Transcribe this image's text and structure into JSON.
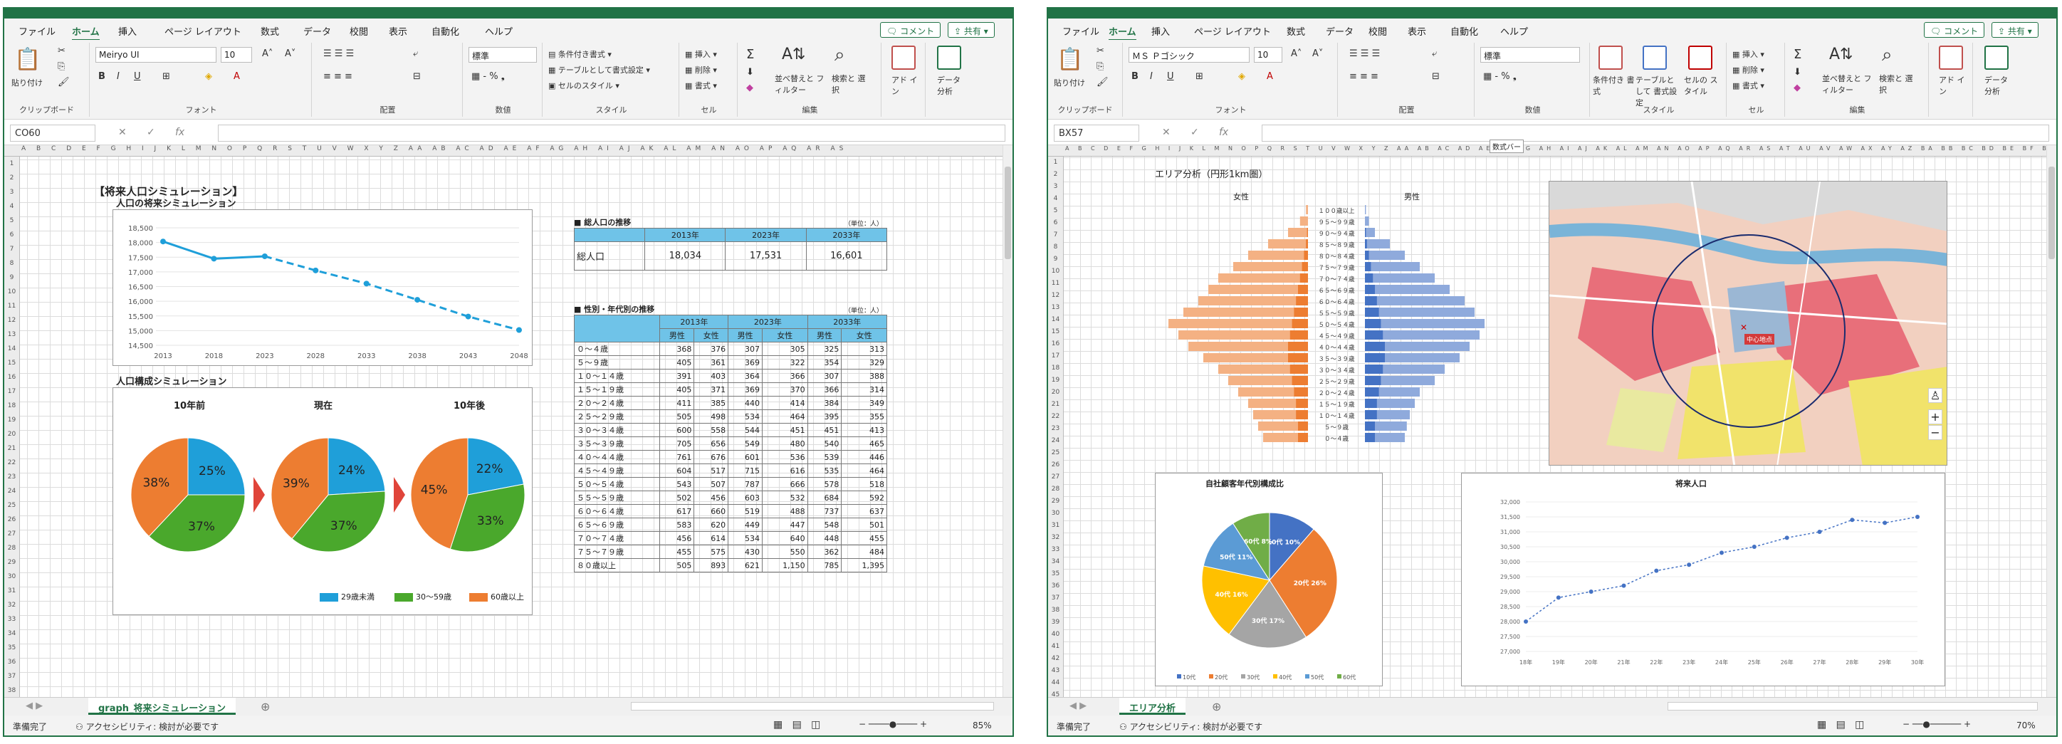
{
  "colors": {
    "excel_green": "#217346",
    "blue": "#1f9fd9",
    "green": "#4aa82c",
    "orange": "#ed7d31",
    "pyr_female": "#f4b183",
    "pyr_male": "#8faadc",
    "pyr_dark_f": "#ed7d31",
    "pyr_dark_m": "#4472c4",
    "table_header": "#6fc3e8"
  },
  "icons": [
    "clipboard-icon",
    "cut-icon",
    "copy-icon",
    "format-painter-icon",
    "bold-icon",
    "italic-icon",
    "underline-icon",
    "align-icon",
    "sum-icon",
    "sort-filter-icon",
    "find-icon",
    "addin-icon",
    "data-analysis-icon",
    "comment-icon",
    "share-icon",
    "add-sheet-icon"
  ],
  "w1": {
    "tabs": [
      "ファイル",
      "ホーム",
      "挿入",
      "ページ レイアウト",
      "数式",
      "データ",
      "校閲",
      "表示",
      "自動化",
      "ヘルプ"
    ],
    "comment_btn": "コメント",
    "share_btn": "共有",
    "ribbon": {
      "paste": "貼り付け",
      "clipboard": "クリップボード",
      "font_name": "Meiryo UI",
      "font_size": "10",
      "font": "フォント",
      "align": "配置",
      "number_format": "標準",
      "number": "数値",
      "cond_format": "条件付き書式",
      "table_format": "テーブルとして書式設定",
      "cell_style": "セルのスタイル",
      "style": "スタイル",
      "insert": "挿入",
      "delete": "削除",
      "format": "書式",
      "cell": "セル",
      "edit": "編集",
      "sort": "並べ替えと フィルター",
      "find": "検索と 選択",
      "addin": "アド イン",
      "data_analysis": "データ 分析"
    },
    "namebox": "CO60",
    "col_headers": "A B C D E F G H I J K L M N O P Q R S T U V W X Y Z AA AB AC AD AE AF AG AH AI AJ AK AL AM AN AO AP AQ AR AS",
    "sheet_title": "【将来人口シミュレーション】",
    "line_title": "人口の将来シミュレーション",
    "pie_section_title": "人口構成シミュレーション",
    "pie_titles": [
      "10年前",
      "現在",
      "10年後"
    ],
    "pie_legend": [
      "29歳未満",
      "30～59歳",
      "60歳以上"
    ],
    "table1_title": "■ 総人口の推移",
    "table1_unit": "（単位：人）",
    "table1_years": [
      "2013年",
      "2023年",
      "2033年"
    ],
    "table1_row_label": "総人口",
    "table1_values": [
      "18,034",
      "17,531",
      "16,601"
    ],
    "table2_title": "■ 性別・年代別の推移",
    "table2_unit": "（単位：人）",
    "table2_sub": [
      "男性",
      "女性"
    ],
    "table2_rows": [
      [
        "０～４歳",
        "368",
        "376",
        "307",
        "305",
        "325",
        "313"
      ],
      [
        "５～９歳",
        "405",
        "361",
        "369",
        "322",
        "354",
        "329"
      ],
      [
        "１０～１４歳",
        "391",
        "403",
        "364",
        "366",
        "307",
        "388"
      ],
      [
        "１５～１９歳",
        "405",
        "371",
        "369",
        "370",
        "366",
        "314"
      ],
      [
        "２０～２４歳",
        "411",
        "385",
        "440",
        "414",
        "384",
        "349"
      ],
      [
        "２５～２９歳",
        "505",
        "498",
        "534",
        "464",
        "395",
        "355"
      ],
      [
        "３０～３４歳",
        "600",
        "558",
        "544",
        "451",
        "451",
        "413"
      ],
      [
        "３５～３９歳",
        "705",
        "656",
        "549",
        "480",
        "540",
        "465"
      ],
      [
        "４０～４４歳",
        "761",
        "676",
        "601",
        "536",
        "539",
        "446"
      ],
      [
        "４５～４９歳",
        "604",
        "517",
        "715",
        "616",
        "535",
        "464"
      ],
      [
        "５０～５４歳",
        "543",
        "507",
        "787",
        "666",
        "578",
        "518"
      ],
      [
        "５５～５９歳",
        "502",
        "456",
        "603",
        "532",
        "684",
        "592"
      ],
      [
        "６０～６４歳",
        "617",
        "660",
        "519",
        "488",
        "737",
        "637"
      ],
      [
        "６５～６９歳",
        "583",
        "620",
        "449",
        "447",
        "548",
        "501"
      ],
      [
        "７０～７４歳",
        "456",
        "614",
        "534",
        "640",
        "448",
        "455"
      ],
      [
        "７５～７９歳",
        "455",
        "575",
        "430",
        "550",
        "362",
        "484"
      ],
      [
        "８０歳以上",
        "505",
        "893",
        "621",
        "1,150",
        "785",
        "1,395"
      ]
    ],
    "sheet_tab": "graph_将来シミュレーション",
    "status_ready": "準備完了",
    "status_access": "アクセシビリティ: 検討が必要です",
    "zoom": "85%"
  },
  "w2": {
    "tabs": [
      "ファイル",
      "ホーム",
      "挿入",
      "ページ レイアウト",
      "数式",
      "データ",
      "校閲",
      "表示",
      "自動化",
      "ヘルプ"
    ],
    "comment_btn": "コメント",
    "share_btn": "共有",
    "ribbon": {
      "paste": "貼り付け",
      "clipboard": "クリップボード",
      "font_name": "ＭＳ Ｐゴシック",
      "font_size": "10",
      "font": "フォント",
      "align": "配置",
      "number_format": "標準",
      "number": "数値",
      "cond_format": "条件付き 書式",
      "table_format": "テーブルとして 書式設定",
      "cell_style": "セルの スタイル",
      "style": "スタイル",
      "insert": "挿入",
      "delete": "削除",
      "format": "書式",
      "cell": "セル",
      "edit": "編集",
      "sort": "並べ替えと フィルター",
      "find": "検索と 選択",
      "addin": "アド イン",
      "data_analysis": "データ 分析"
    },
    "namebox": "BX57",
    "formula_tooltip": "数式バー",
    "area_title": "エリア分析（円形1km圏）",
    "pyr_female": "女性",
    "pyr_male": "男性",
    "pyr_ages": [
      "１００歳以上",
      "９５～９９歳",
      "９０～９４歳",
      "８５～８９歳",
      "８０～８４歳",
      "７５～７９歳",
      "７０～７４歳",
      "６５～６９歳",
      "６０～６４歳",
      "５５～５９歳",
      "５０～５４歳",
      "４５～４９歳",
      "４０～４４歳",
      "３５～３９歳",
      "３０～３４歳",
      "２５～２９歳",
      "２０～２４歳",
      "１５～１９歳",
      "１０～１４歳",
      "５～９歳",
      "０～４歳"
    ],
    "pie2_title": "自社顧客年代別構成比",
    "pie2_labels": [
      "10代 10%",
      "20代 26%",
      "30代 17%",
      "40代 16%",
      "50代 11%",
      "60代 8%"
    ],
    "line2_title": "将来人口",
    "line2_x": [
      "18年",
      "19年",
      "20年",
      "21年",
      "22年",
      "23年",
      "24年",
      "25年",
      "26年",
      "27年",
      "28年",
      "29年",
      "30年"
    ],
    "line2_ylabels": [
      "32,000",
      "31,500",
      "31,000",
      "30,500",
      "30,000",
      "29,500",
      "29,000",
      "28,500",
      "28,000",
      "27,500",
      "27,000"
    ],
    "map_pin": "中心地点",
    "sheet_tab": "エリア分析",
    "status_ready": "準備完了",
    "status_access": "アクセシビリティ: 検討が必要です",
    "zoom": "70%"
  },
  "chart_data": [
    {
      "type": "line",
      "title": "人口の将来シミュレーション",
      "categories": [
        "2013",
        "2018",
        "2023",
        "2028",
        "2033",
        "2038",
        "2043",
        "2048"
      ],
      "values": [
        18034,
        17450,
        17531,
        17050,
        16601,
        16050,
        15480,
        15020
      ],
      "ylim": [
        14500,
        18500
      ],
      "yticks": [
        "18,500",
        "18,000",
        "17,500",
        "17,000",
        "16,500",
        "16,000",
        "15,500",
        "15,000",
        "14,500"
      ],
      "note": "solid through 2023, dashed after"
    },
    {
      "type": "pie",
      "title": "10年前",
      "values": [
        25,
        37,
        38
      ]
    },
    {
      "type": "pie",
      "title": "現在",
      "values": [
        24,
        37,
        39
      ]
    },
    {
      "type": "pie",
      "title": "10年後",
      "values": [
        22,
        33,
        45
      ]
    },
    {
      "type": "pie",
      "title": "自社顧客年代別構成比",
      "values": [
        10,
        26,
        17,
        16,
        11,
        8
      ],
      "categories": [
        "10代",
        "20代",
        "30代",
        "40代",
        "50代",
        "60代"
      ]
    },
    {
      "type": "line",
      "title": "将来人口",
      "categories": [
        "18年",
        "19年",
        "20年",
        "21年",
        "22年",
        "23年",
        "24年",
        "25年",
        "26年",
        "27年",
        "28年",
        "29年",
        "30年"
      ],
      "values": [
        28000,
        28800,
        29000,
        29200,
        29700,
        29900,
        30300,
        30500,
        30800,
        31000,
        31400,
        31300,
        31500
      ],
      "ylim": [
        27000,
        32000
      ]
    }
  ]
}
